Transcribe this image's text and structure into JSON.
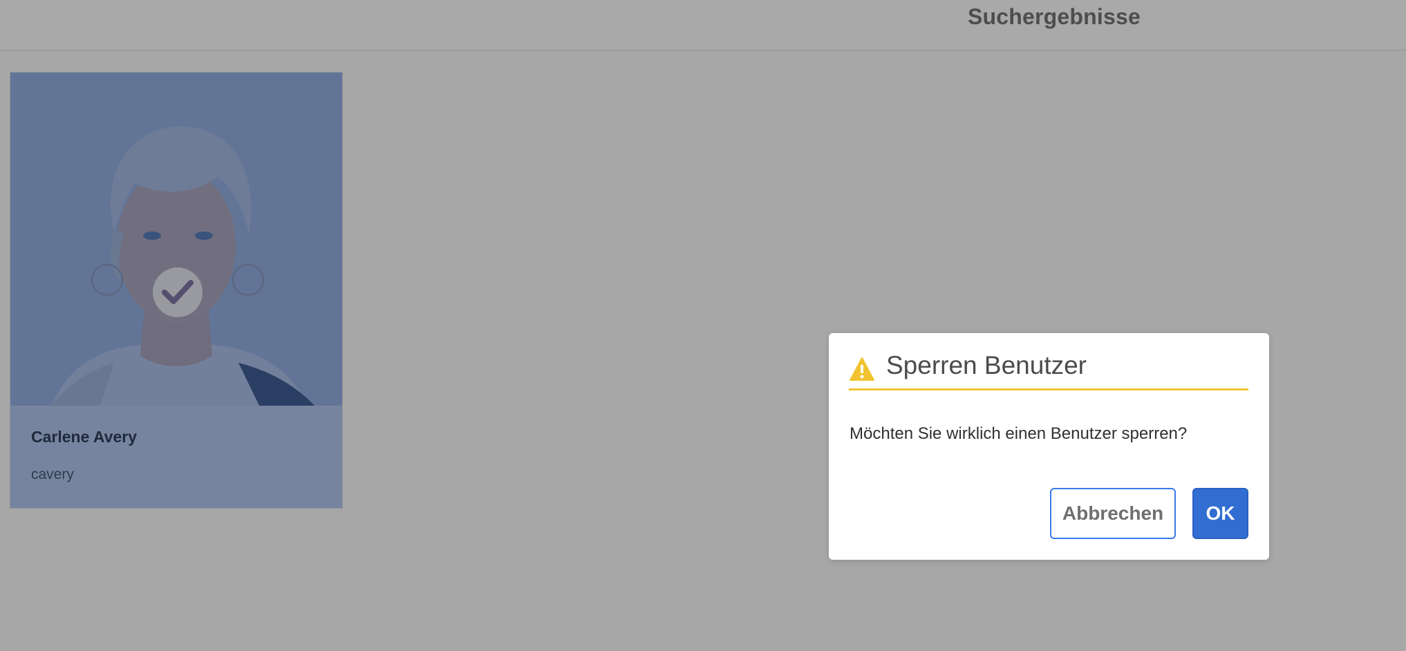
{
  "header": {
    "title": "Suchergebnisse"
  },
  "results": [
    {
      "name": "Carlene Avery",
      "username": "cavery",
      "selected": true
    }
  ],
  "dialog": {
    "title": "Sperren Benutzer",
    "message": "Möchten Sie wirklich einen Benutzer sperren?",
    "cancel_label": "Abbrechen",
    "ok_label": "OK",
    "icon": "warning-icon"
  },
  "colors": {
    "accent": "#326ed2",
    "warning": "#f1c330",
    "selection_overlay": "#446ec4"
  }
}
